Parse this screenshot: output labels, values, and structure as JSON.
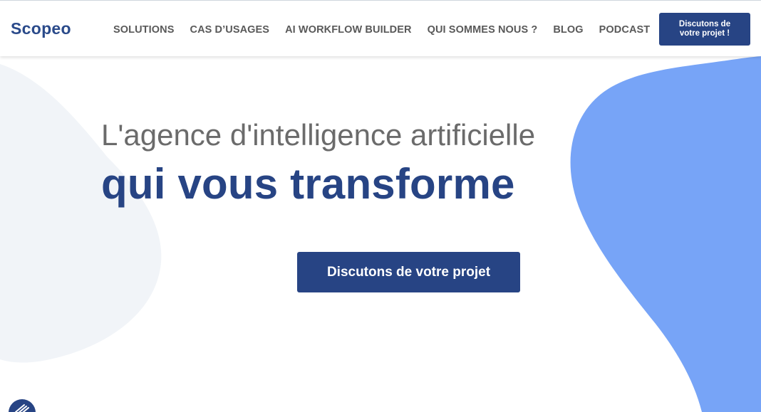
{
  "header": {
    "logo": "Scopeo",
    "nav": [
      {
        "label": "SOLUTIONS"
      },
      {
        "label": "CAS D’USAGES"
      },
      {
        "label": "AI WORKFLOW BUILDER"
      },
      {
        "label": "QUI SOMMES NOUS ?"
      },
      {
        "label": "BLOG"
      },
      {
        "label": "PODCAST"
      }
    ],
    "cta_line1": "Discutons de",
    "cta_line2": "votre projet !"
  },
  "hero": {
    "line1": "L'agence d'intelligence artificielle",
    "line2": "qui vous transforme",
    "cta": "Discutons de votre projet"
  },
  "chat": {
    "icon": "chat-icon"
  },
  "colors": {
    "brand": "#274484",
    "blob_blue": "#77a4f7",
    "blob_light": "#f0f4f8",
    "nav_text": "#595959"
  }
}
